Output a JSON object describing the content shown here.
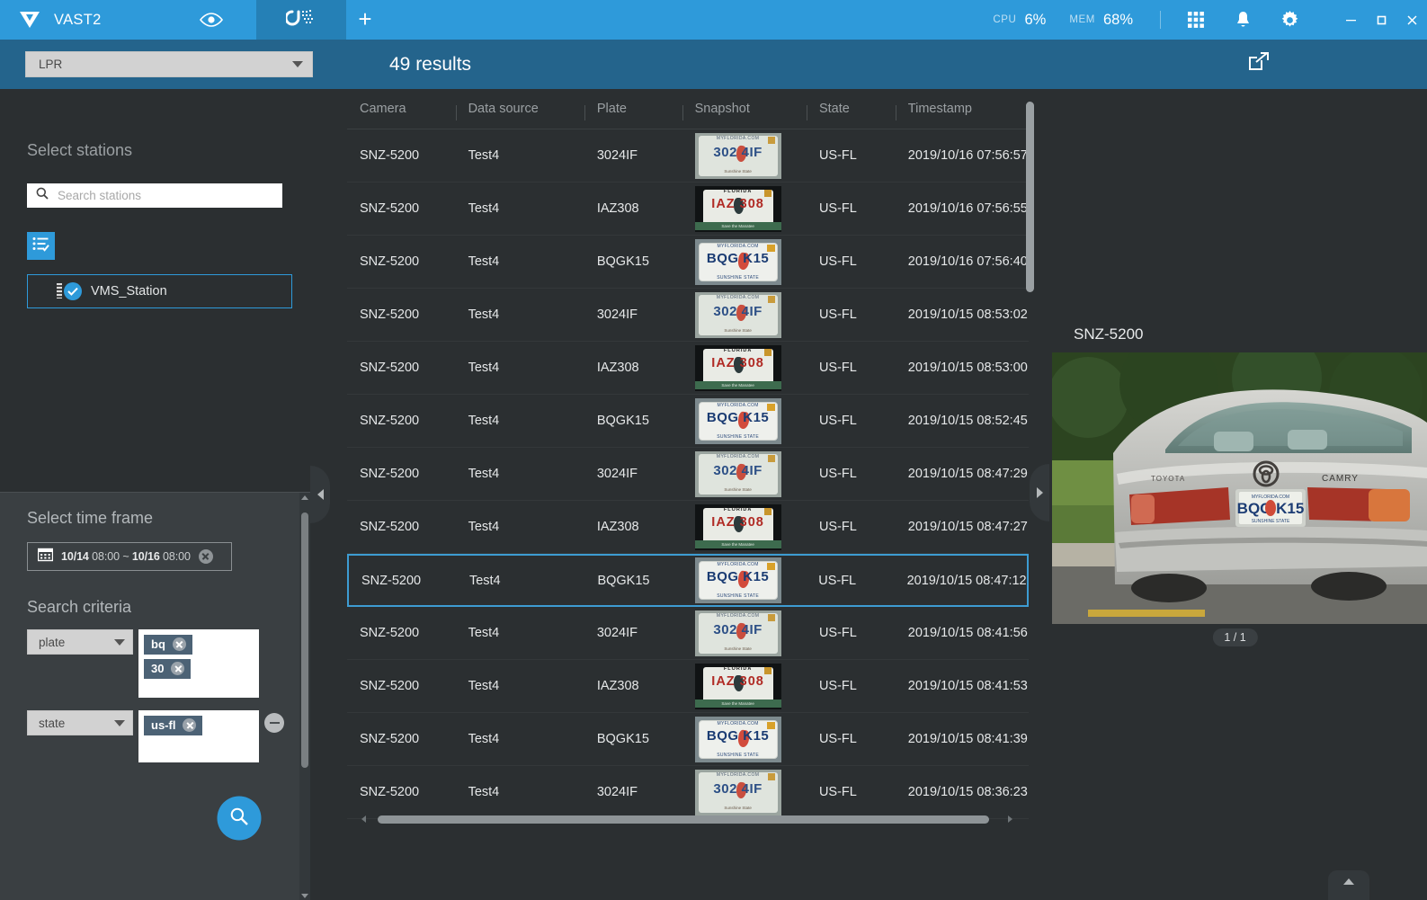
{
  "titlebar": {
    "brand": "VAST2",
    "tabs": [
      {
        "name": "eye-tab",
        "icon": "eye-icon",
        "active": false
      },
      {
        "name": "lpr-search-tab",
        "icon": "magnet-search-icon",
        "active": true
      }
    ],
    "add_tab_label": "+",
    "cpu_label": "CPU",
    "cpu_value": "6%",
    "mem_label": "MEM",
    "mem_value": "68%",
    "icons": [
      "grid-icon",
      "bell-icon",
      "gear-icon"
    ],
    "window_controls": [
      "minimize",
      "maximize",
      "close"
    ]
  },
  "searchbar": {
    "mode_select_value": "LPR",
    "results_text": "49 results",
    "export_icon": "export-icon"
  },
  "left_panel": {
    "stations_title": "Select stations",
    "search_placeholder": "Search stations",
    "search_value": "",
    "list_mode_icon": "list-check-icon",
    "stations": [
      {
        "label": "VMS_Station",
        "checked": true
      }
    ],
    "timeframe_title": "Select time frame",
    "timeframe_start_date": "10/14",
    "timeframe_start_time": "08:00",
    "timeframe_sep": "~",
    "timeframe_end_date": "10/16",
    "timeframe_end_time": "08:00",
    "criteria_title": "Search criteria",
    "criteria": [
      {
        "field": "plate",
        "tags": [
          "bq",
          "30"
        ]
      },
      {
        "field": "state",
        "tags": [
          "us-fl"
        ]
      }
    ],
    "search_button_icon": "search-icon"
  },
  "table": {
    "columns": [
      "Camera",
      "Data source",
      "Plate",
      "Snapshot",
      "State",
      "Timestamp"
    ],
    "rows": [
      {
        "camera": "SNZ-5200",
        "source": "Test4",
        "plate": "3024IF",
        "state": "US-FL",
        "timestamp": "2019/10/16 07:56:57",
        "selected": false,
        "plate_style": "pl-3024"
      },
      {
        "camera": "SNZ-5200",
        "source": "Test4",
        "plate": "IAZ308",
        "state": "US-FL",
        "timestamp": "2019/10/16 07:56:55",
        "selected": false,
        "plate_style": "pl-iaz"
      },
      {
        "camera": "SNZ-5200",
        "source": "Test4",
        "plate": "BQGK15",
        "state": "US-FL",
        "timestamp": "2019/10/16 07:56:40",
        "selected": false,
        "plate_style": "pl-bqgk"
      },
      {
        "camera": "SNZ-5200",
        "source": "Test4",
        "plate": "3024IF",
        "state": "US-FL",
        "timestamp": "2019/10/15 08:53:02",
        "selected": false,
        "plate_style": "pl-3024"
      },
      {
        "camera": "SNZ-5200",
        "source": "Test4",
        "plate": "IAZ308",
        "state": "US-FL",
        "timestamp": "2019/10/15 08:53:00",
        "selected": false,
        "plate_style": "pl-iaz"
      },
      {
        "camera": "SNZ-5200",
        "source": "Test4",
        "plate": "BQGK15",
        "state": "US-FL",
        "timestamp": "2019/10/15 08:52:45",
        "selected": false,
        "plate_style": "pl-bqgk"
      },
      {
        "camera": "SNZ-5200",
        "source": "Test4",
        "plate": "3024IF",
        "state": "US-FL",
        "timestamp": "2019/10/15 08:47:29",
        "selected": false,
        "plate_style": "pl-3024"
      },
      {
        "camera": "SNZ-5200",
        "source": "Test4",
        "plate": "IAZ308",
        "state": "US-FL",
        "timestamp": "2019/10/15 08:47:27",
        "selected": false,
        "plate_style": "pl-iaz"
      },
      {
        "camera": "SNZ-5200",
        "source": "Test4",
        "plate": "BQGK15",
        "state": "US-FL",
        "timestamp": "2019/10/15 08:47:12",
        "selected": true,
        "plate_style": "pl-bqgk"
      },
      {
        "camera": "SNZ-5200",
        "source": "Test4",
        "plate": "3024IF",
        "state": "US-FL",
        "timestamp": "2019/10/15 08:41:56",
        "selected": false,
        "plate_style": "pl-3024"
      },
      {
        "camera": "SNZ-5200",
        "source": "Test4",
        "plate": "IAZ308",
        "state": "US-FL",
        "timestamp": "2019/10/15 08:41:53",
        "selected": false,
        "plate_style": "pl-iaz"
      },
      {
        "camera": "SNZ-5200",
        "source": "Test4",
        "plate": "BQGK15",
        "state": "US-FL",
        "timestamp": "2019/10/15 08:41:39",
        "selected": false,
        "plate_style": "pl-bqgk"
      },
      {
        "camera": "SNZ-5200",
        "source": "Test4",
        "plate": "3024IF",
        "state": "US-FL",
        "timestamp": "2019/10/15 08:36:23",
        "selected": false,
        "plate_style": "pl-3024"
      }
    ]
  },
  "right_panel": {
    "camera_title": "SNZ-5200",
    "page_indicator": "1 / 1",
    "photo_alt": "Silver Toyota Camry rear view with Florida plate BQGK15"
  },
  "plate_art": {
    "bqgk": {
      "top": "MYFLORIDA.COM",
      "main": "BQG   K15",
      "bottom": "SUNSHINE STATE"
    },
    "iaz": {
      "top": "FLORIDA",
      "main": "IAZ   308",
      "bottom": "Save the Manatee"
    },
    "p3024": {
      "top": "MYFLORIDA.COM",
      "main": "302   4IF",
      "bottom": "Sunshine State"
    }
  },
  "colors": {
    "accent": "#2e9ada",
    "titlebar": "#2e9ada",
    "searchbar": "#24648c",
    "panel_bg": "#2b2f31",
    "panel_alt": "#3a3f42",
    "selected_border": "#3d9cd2"
  }
}
